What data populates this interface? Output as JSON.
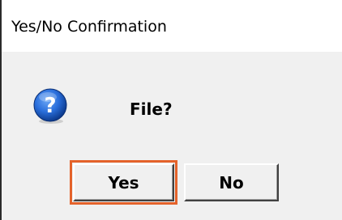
{
  "window": {
    "title": "Yes/No Confirmation"
  },
  "dialog": {
    "icon": "question-icon",
    "message": "File?"
  },
  "buttons": {
    "yes_label": "Yes",
    "no_label": "No",
    "focused": "yes"
  },
  "colors": {
    "focus_outline": "#e4622a",
    "icon_blue": "#1f5fd0",
    "dialog_background": "#f0f0f0",
    "titlebar_background": "#ffffff"
  }
}
